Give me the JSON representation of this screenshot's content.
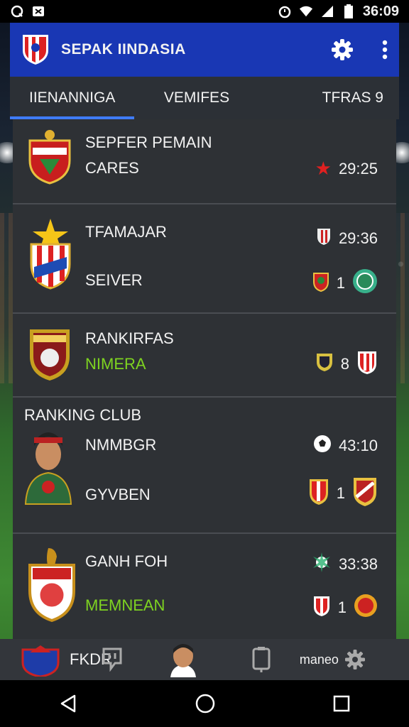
{
  "status_bar": {
    "time": "36:09",
    "icons": [
      "signal-q-icon",
      "cast-icon",
      "alarm-icon",
      "wifi-icon",
      "cell-icon",
      "battery-icon"
    ]
  },
  "app_bar": {
    "title": "SEPAK IINDASIA",
    "accent_color": "#1937b4"
  },
  "tabs": [
    {
      "label": "IIENANNIGA",
      "active": true
    },
    {
      "label": "VEMIFES",
      "active": false
    },
    {
      "label": "TFRAS 9",
      "active": false
    }
  ],
  "cards": [
    {
      "name": "SEPFER PEMAIN",
      "sub": "CARES",
      "stat_top": "29:25",
      "icon_top": "star-icon"
    },
    {
      "name": "TFAMAJAR",
      "sub": "SEIVER",
      "stat_top": "29:36",
      "stat_bottom": "1"
    },
    {
      "name": "RANKIRFAS",
      "sub": "NIMERA",
      "stat_bottom": "8"
    },
    {
      "header": "RANKING CLUB",
      "name": "NMMBGR",
      "sub": "GYVBEN",
      "stat_top": "43:10",
      "stat_bottom": "1"
    },
    {
      "name": "GANH FOH",
      "sub": "MEMNEAN",
      "stat_top": "33:38",
      "stat_bottom": "1"
    }
  ],
  "bottom_nav": {
    "left_label": "FKDR",
    "right_label": "maneo"
  }
}
